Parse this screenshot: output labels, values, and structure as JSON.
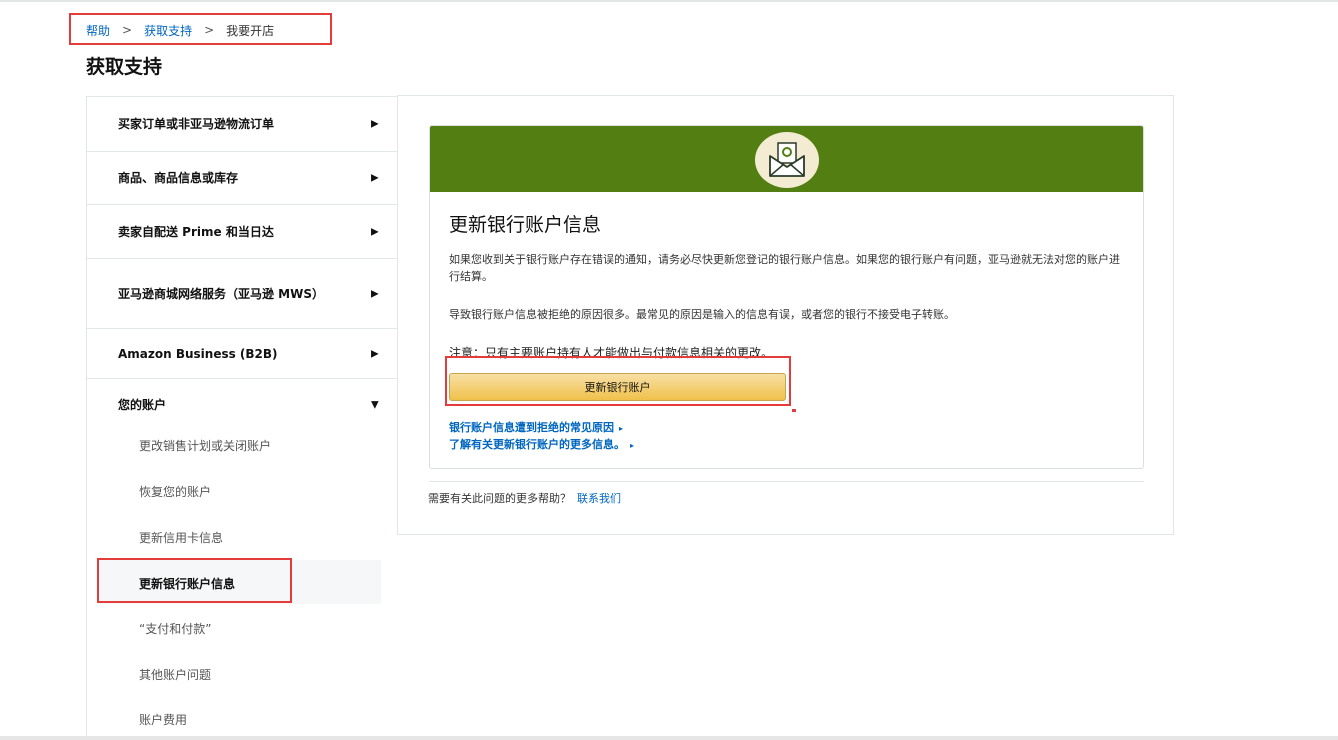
{
  "breadcrumb": [
    "帮助",
    "获取支持",
    "我要开店"
  ],
  "breadcrumb_separator": ">",
  "page_title": "获取支持",
  "sidebar": {
    "categories": [
      {
        "label": "买家订单或非亚马逊物流订单",
        "state": "collapsed"
      },
      {
        "label": "商品、商品信息或库存",
        "state": "collapsed"
      },
      {
        "label": "卖家自配送 Prime 和当日达",
        "state": "collapsed"
      },
      {
        "label": "亚马逊商城网络服务（亚马逊 MWS）",
        "state": "collapsed"
      },
      {
        "label": "Amazon Business (B2B)",
        "state": "collapsed"
      },
      {
        "label": "您的账户",
        "state": "expanded"
      }
    ],
    "subitems": [
      {
        "label": "更改销售计划或关闭账户"
      },
      {
        "label": "恢复您的账户"
      },
      {
        "label": "更新信用卡信息"
      },
      {
        "label": "更新银行账户信息",
        "active": true
      },
      {
        "label": "“支付和付款”"
      },
      {
        "label": "其他账户问题"
      },
      {
        "label": "账户费用"
      }
    ],
    "icons": {
      "collapsed": "▶",
      "expanded": "▼"
    }
  },
  "card": {
    "banner_color": "#537e12",
    "banner_icon": "envelope-money-icon",
    "title": "更新银行账户信息",
    "paragraph_1": "如果您收到关于银行账户存在错误的通知，请务必尽快更新您登记的银行账户信息。如果您的银行账户有问题，亚马逊就无法对您的账户进行结算。",
    "paragraph_2": "导致银行账户信息被拒绝的原因很多。最常见的原因是输入的信息有误，或者您的银行不接受电子转账。",
    "note": "注意：只有主要账户持有人才能做出与付款信息相关的更改。",
    "button_label": "更新银行账户",
    "links": [
      "银行账户信息遭到拒绝的常见原因",
      "了解有关更新银行账户的更多信息。"
    ],
    "link_caret": "▸"
  },
  "help": {
    "prompt": "需要有关此问题的更多帮助？",
    "contact": "联系我们"
  },
  "colors": {
    "link": "#0066c0",
    "highlight": "#e43b3b",
    "button": "#f0c14b"
  }
}
